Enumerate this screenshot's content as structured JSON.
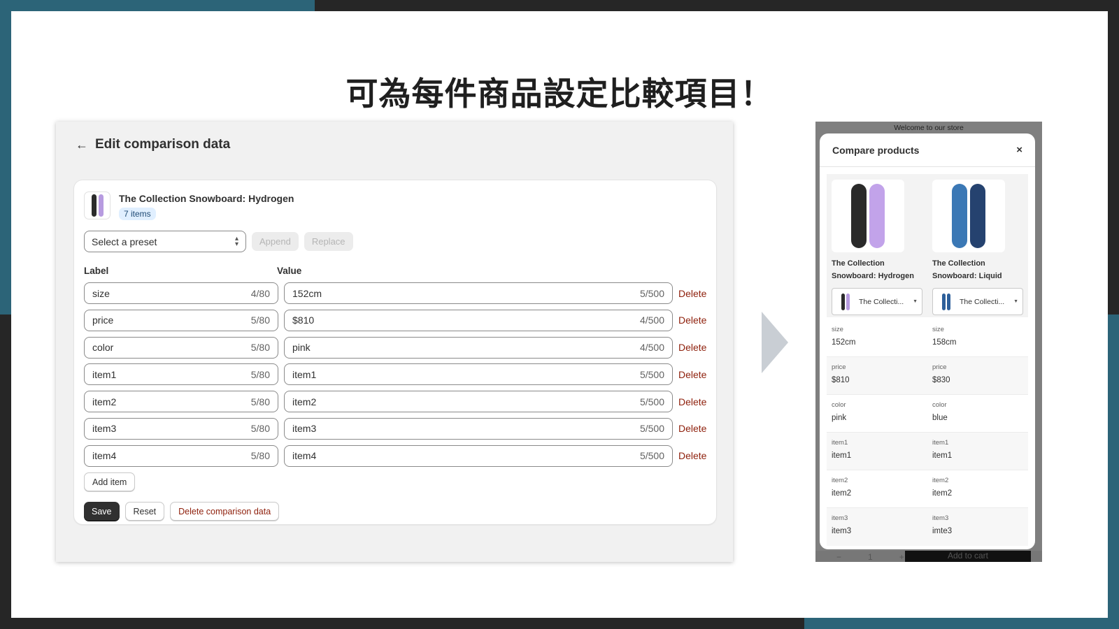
{
  "headline": "可為每件商品設定比較項目！",
  "admin": {
    "title": "Edit comparison data",
    "product_name": "The Collection Snowboard: Hydrogen",
    "items_badge": "7 items",
    "preset_placeholder": "Select a preset",
    "append_label": "Append",
    "replace_label": "Replace",
    "label_header": "Label",
    "value_header": "Value",
    "delete_label": "Delete",
    "rows": [
      {
        "label": "size",
        "label_count": "4/80",
        "value": "152cm",
        "value_count": "5/500"
      },
      {
        "label": "price",
        "label_count": "5/80",
        "value": "$810",
        "value_count": "4/500"
      },
      {
        "label": "color",
        "label_count": "5/80",
        "value": "pink",
        "value_count": "4/500"
      },
      {
        "label": "item1",
        "label_count": "5/80",
        "value": "item1",
        "value_count": "5/500"
      },
      {
        "label": "item2",
        "label_count": "5/80",
        "value": "item2",
        "value_count": "5/500"
      },
      {
        "label": "item3",
        "label_count": "5/80",
        "value": "item3",
        "value_count": "5/500"
      },
      {
        "label": "item4",
        "label_count": "5/80",
        "value": "item4",
        "value_count": "5/500"
      }
    ],
    "add_item_label": "Add item",
    "save_label": "Save",
    "reset_label": "Reset",
    "delete_data_label": "Delete comparison data"
  },
  "store": {
    "banner": "Welcome to our store",
    "modal_title": "Compare products",
    "close_glyph": "×",
    "products": [
      {
        "name": "The Collection Snowboard: Hydrogen",
        "select_value": "The Collecti..."
      },
      {
        "name": "The Collection Snowboard: Liquid",
        "select_value": "The Collecti..."
      }
    ],
    "compare_rows": [
      {
        "label": "size",
        "values": [
          "152cm",
          "158cm"
        ]
      },
      {
        "label": "price",
        "values": [
          "$810",
          "$830"
        ]
      },
      {
        "label": "color",
        "values": [
          "pink",
          "blue"
        ]
      },
      {
        "label": "item1",
        "values": [
          "item1",
          "item1"
        ]
      },
      {
        "label": "item2",
        "values": [
          "item2",
          "item2"
        ]
      },
      {
        "label": "item3",
        "values": [
          "item3",
          "imte3"
        ]
      }
    ],
    "qty_minus": "−",
    "qty_value": "1",
    "qty_plus": "+",
    "add_to_cart": "Add to cart"
  }
}
